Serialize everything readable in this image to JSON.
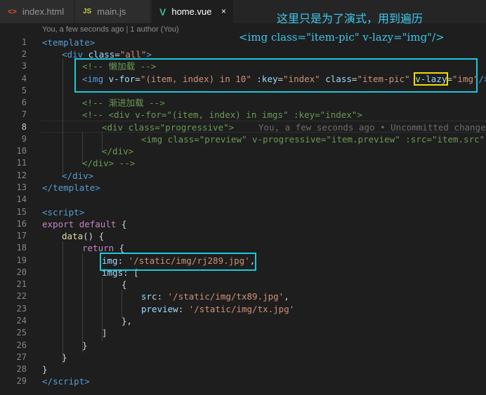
{
  "tabs": [
    {
      "label": "index.html",
      "icon": "<>",
      "icon_color": "#e44d26",
      "active": false
    },
    {
      "label": "main.js",
      "icon": "JS",
      "icon_color": "#cbcb41",
      "active": false
    },
    {
      "label": "home.vue",
      "icon": "V",
      "icon_color": "#41b883",
      "active": true,
      "close": "×"
    }
  ],
  "annotations": {
    "note": "这里只是为了演式，用到遍历",
    "snippet": "<img class=\"item-pic\" v-lazy=\"img\"/>"
  },
  "blame": "You, a few seconds ago | 1 author (You)",
  "line_numbers": [
    "1",
    "2",
    "3",
    "4",
    "5",
    "6",
    "7",
    "8",
    "9",
    "10",
    "11",
    "12",
    "13",
    "14",
    "15",
    "16",
    "17",
    "18",
    "19",
    "20",
    "21",
    "22",
    "23",
    "24",
    "25",
    "26",
    "27",
    "28",
    "29"
  ],
  "current_line": "8",
  "code": {
    "l1": [
      "<",
      "template",
      ">"
    ],
    "l2": [
      "<",
      "div",
      " ",
      "class",
      "=",
      "\"all\"",
      ">"
    ],
    "l3": "<!-- 懒加载 -->",
    "l4": [
      "<",
      "img",
      " ",
      "v-for",
      "=",
      "\"(item, index) in 10\"",
      " ",
      ":key",
      "=",
      "\"index\"",
      " ",
      "class",
      "=",
      "\"item-pic\"",
      " ",
      "v-lazy",
      "=",
      "\"img\"",
      "/>"
    ],
    "l6": "<!-- 渐进加载 -->",
    "l7": "<!-- <div v-for=\"(item, index) in imgs\" :key=\"index\">",
    "l8": "<div class=\"progressive\">",
    "l8_ghost": "You, a few seconds ago • Uncommitted changes",
    "l9": "<img class=\"preview\" v-progressive=\"item.preview\" :src=\"item.src\" />",
    "l10": "</div>",
    "l11": "</div> -->",
    "l12": [
      "</",
      "div",
      ">"
    ],
    "l13": [
      "</",
      "template",
      ">"
    ],
    "l15": [
      "<",
      "script",
      ">"
    ],
    "l16": [
      "export",
      " ",
      "default",
      " {"
    ],
    "l17": [
      "data",
      "() {"
    ],
    "l18": [
      "return",
      " {"
    ],
    "l19": [
      "img",
      ": ",
      "'/static/img/rj289.jpg'",
      ","
    ],
    "l20": [
      "imgs",
      ": ["
    ],
    "l21": "{",
    "l22": [
      "src",
      ": ",
      "'/static/img/tx89.jpg'",
      ","
    ],
    "l23": [
      "preview",
      ": ",
      "'/static/img/tx.jpg'"
    ],
    "l24": "},",
    "l25": "]",
    "l26": "}",
    "l27": "}",
    "l28": "}",
    "l29": [
      "</",
      "script",
      ">"
    ]
  }
}
